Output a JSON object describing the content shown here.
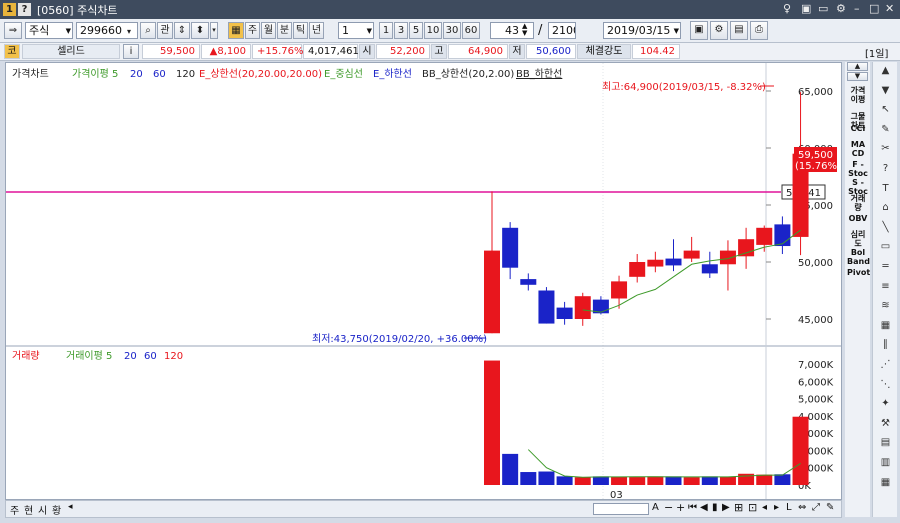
{
  "window": {
    "title": "[0560] 주식차트",
    "help_icon": "?",
    "corner": "[1일]"
  },
  "toolbar": {
    "market": "주식",
    "code": "299660",
    "search_icon": "⌕",
    "relation_label": "관",
    "periods": [
      "주",
      "월",
      "분",
      "틱",
      "년"
    ],
    "period_unit": "1",
    "numbers": [
      "1",
      "3",
      "5",
      "10",
      "30",
      "60"
    ],
    "count": "43",
    "total": "2100",
    "date": "2019/03/15"
  },
  "info": {
    "tag": "코",
    "name": "셀리드",
    "info_btn": "i",
    "price": "59,500",
    "change": "▲8,100",
    "rate": "+15.76%",
    "volume": "4,017,461",
    "open_label": "시",
    "open": "52,200",
    "high_label": "고",
    "high": "64,900",
    "low_label": "저",
    "low": "50,600",
    "strength_label": "체결강도",
    "strength": "104.42"
  },
  "legend_price": [
    "가격차트",
    "가격이평 5",
    "20",
    "60",
    "120",
    "E_상한선(20,20.00,20.00)",
    "E_중심선",
    "E_하한선",
    "BB_상한선(20,2.00)",
    "BB_하한선"
  ],
  "legend_volume": [
    "거래량",
    "거래이평 5",
    "20",
    "60",
    "120"
  ],
  "annotations": {
    "high": "최고:64,900(2019/03/15, -8.32%)",
    "low": "최저:43,750(2019/02/20, +36.00%)",
    "current_price": "59,500",
    "current_rate": "(15.76%)",
    "line_value": "56,141"
  },
  "x_label": "03",
  "price_ticks": [
    "65,000",
    "60,000",
    "55,000",
    "50,000",
    "45,000"
  ],
  "volume_ticks": [
    "7,000K",
    "6,000K",
    "5,000K",
    "4,000K",
    "3,000K",
    "2,000K",
    "1,000K",
    "0K"
  ],
  "right_items": [
    "가격\n이평",
    "그물\n차트",
    "CCI",
    "MA\nCD",
    "F -\nStoc",
    "S -\nStoc",
    "거래\n량",
    "OBV",
    "심리\n도",
    "Bol\nBand",
    "Pivot"
  ],
  "bottom_tabs": [
    "주",
    "현",
    "시",
    "황"
  ],
  "colors": {
    "up": "#e8161d",
    "down": "#1a23c8",
    "ma": "#3e9a2a",
    "pink": "#e0129a"
  },
  "chart_data": {
    "type": "candlestick",
    "price_range": [
      42000,
      67000
    ],
    "candles": [
      {
        "o": 43750,
        "h": 56200,
        "l": 43750,
        "c": 51000
      },
      {
        "o": 53000,
        "h": 53500,
        "l": 48500,
        "c": 49500
      },
      {
        "o": 48500,
        "h": 49000,
        "l": 47500,
        "c": 48000
      },
      {
        "o": 47500,
        "h": 47800,
        "l": 44600,
        "c": 44600
      },
      {
        "o": 46000,
        "h": 46500,
        "l": 44500,
        "c": 45000
      },
      {
        "o": 45000,
        "h": 47300,
        "l": 44400,
        "c": 47000
      },
      {
        "o": 46700,
        "h": 47000,
        "l": 45400,
        "c": 45500
      },
      {
        "o": 46800,
        "h": 48800,
        "l": 45900,
        "c": 48300
      },
      {
        "o": 48700,
        "h": 50700,
        "l": 48200,
        "c": 50000
      },
      {
        "o": 49600,
        "h": 50900,
        "l": 49100,
        "c": 50200
      },
      {
        "o": 50300,
        "h": 52000,
        "l": 49200,
        "c": 49700
      },
      {
        "o": 50300,
        "h": 52200,
        "l": 50000,
        "c": 51000
      },
      {
        "o": 49800,
        "h": 50900,
        "l": 48600,
        "c": 49000
      },
      {
        "o": 49800,
        "h": 51900,
        "l": 47500,
        "c": 51000
      },
      {
        "o": 50500,
        "h": 53000,
        "l": 49400,
        "c": 52000
      },
      {
        "o": 51500,
        "h": 53200,
        "l": 50900,
        "c": 53000
      },
      {
        "o": 53300,
        "h": 54000,
        "l": 50700,
        "c": 51400
      },
      {
        "o": 52200,
        "h": 64900,
        "l": 50600,
        "c": 59500
      }
    ],
    "price_ma5": [
      null,
      null,
      null,
      null,
      null,
      45800,
      45600,
      46200,
      47100,
      47600,
      48700,
      49800,
      50100,
      50300,
      50800,
      51300,
      51600,
      52800
    ],
    "volume_range": [
      0,
      7500
    ],
    "volume": [
      7200,
      1800,
      750,
      780,
      500,
      450,
      500,
      470,
      460,
      500,
      500,
      450,
      500,
      470,
      650,
      600,
      620,
      3950
    ],
    "volume_ma5": [
      null,
      null,
      2050,
      1000,
      520,
      450,
      470,
      470,
      480,
      480,
      470,
      470,
      470,
      470,
      520,
      570,
      570,
      1250
    ],
    "h_line": 56141
  }
}
